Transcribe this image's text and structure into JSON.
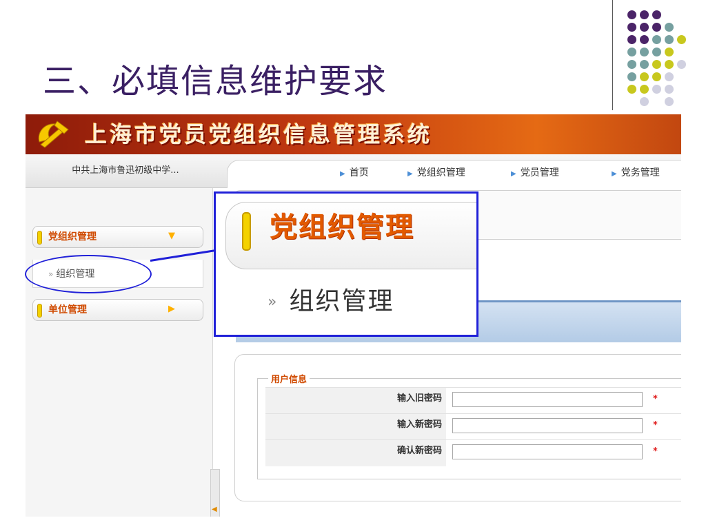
{
  "slide": {
    "title": "三、必填信息维护要求"
  },
  "app": {
    "banner_title": "上海市党员党组织信息管理系统",
    "org_name": "中共上海市鲁迅初级中学...",
    "nav": [
      "首页",
      "党组织管理",
      "党员管理",
      "党务管理"
    ]
  },
  "sidebar": {
    "groups": [
      {
        "label": "党组织管理",
        "icon": "chevron-down-icon",
        "items": [
          "组织管理"
        ]
      },
      {
        "label": "单位管理",
        "icon": "chevron-right-icon",
        "items": []
      }
    ]
  },
  "zoom": {
    "title": "党组织管理",
    "item": "组织管理"
  },
  "form": {
    "legend": "用户信息",
    "fields": [
      {
        "label": "输入旧密码",
        "value": "",
        "required": "*"
      },
      {
        "label": "输入新密码",
        "value": "",
        "required": "*"
      },
      {
        "label": "确认新密码",
        "value": "",
        "required": "*"
      }
    ]
  },
  "colors": {
    "title": "#3a1f63",
    "banner": "#c23a10",
    "accent_orange": "#d04a00",
    "annotation_blue": "#2020d8",
    "dots": [
      "#4b2468",
      "#76a0a0",
      "#c8c81e",
      "#d0d0e0"
    ]
  }
}
